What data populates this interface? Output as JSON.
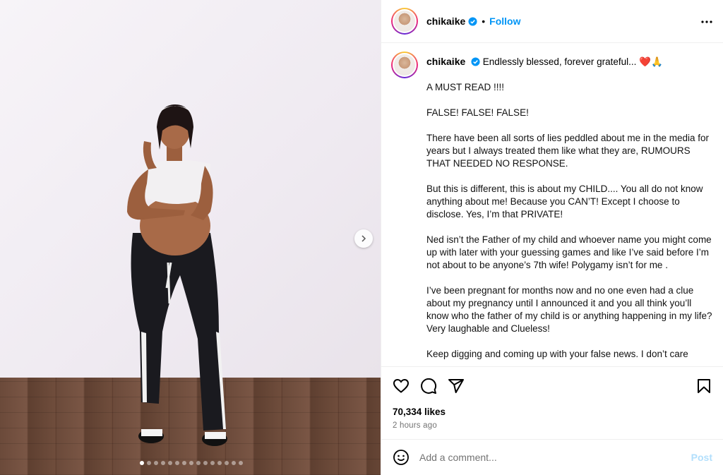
{
  "post": {
    "username": "chikaike",
    "follow_label": "Follow",
    "separator": "•",
    "verified_color": "#0095f6",
    "media": {
      "slide_count": 15,
      "active_slide": 1
    },
    "caption": {
      "first_line": "Endlessly blessed, forever grateful...",
      "first_line_emojis": "❤️🙏",
      "paragraphs": [
        "A MUST READ !!!!",
        "FALSE! FALSE! FALSE!",
        "There have been all sorts of lies peddled about me in the media for years but I always treated them like what they are, RUMOURS THAT NEEDED NO RESPONSE.",
        "But this is different, this is about my CHILD.... You all do not know anything about me! Because you CAN’T! Except I choose to disclose. Yes, I’m that PRIVATE!",
        "Ned isn’t the Father of my child and whoever name you might come up with later with your guessing games and like I’ve said before I’m not about to be anyone’s 7th wife! Polygamy isn’t for me .",
        "I’ve been pregnant for months now and no one even had a clue about my pregnancy until I announced it and you all think you’ll know who the father of my child is or anything happening in my life? Very laughable and Clueless!",
        "Keep digging and coming up with your false news. I don’t care"
      ]
    },
    "likes": "70,334 likes",
    "time_ago": "2 hours ago",
    "comment_placeholder": "Add a comment...",
    "post_label": "Post"
  },
  "icons": {
    "like": "heart-icon",
    "comment": "comment-icon",
    "share": "paper-plane-icon",
    "save": "bookmark-icon",
    "more": "more-options-icon",
    "emoji": "emoji-icon",
    "next": "chevron-right-icon"
  }
}
